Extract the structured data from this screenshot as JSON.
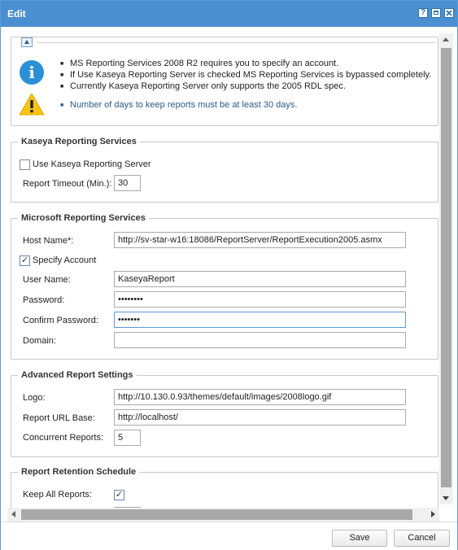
{
  "window": {
    "title": "Edit",
    "controls": {
      "help": "?",
      "restore": "□",
      "close": "✕"
    }
  },
  "info": {
    "messages": [
      "MS Reporting Services 2008 R2 requires you to specify an account.",
      "If Use Kaseya Reporting Server is checked MS Reporting Services is bypassed completely.",
      "Currently Kaseya Reporting Server only supports the 2005 RDL spec."
    ],
    "warning": "Number of days to keep reports must be at least 30 days."
  },
  "kaseya": {
    "legend": "Kaseya Reporting Services",
    "use_server_label": "Use Kaseya Reporting Server",
    "use_server_checked": false,
    "timeout_label": "Report Timeout (Min.):",
    "timeout_value": "30"
  },
  "microsoft": {
    "legend": "Microsoft Reporting Services",
    "host_label": "Host Name*:",
    "host_value": "http://sv-star-w16:18086/ReportServer/ReportExecution2005.asmx",
    "specify_account_label": "Specify Account",
    "specify_account_checked": true,
    "username_label": "User Name:",
    "username_value": "KaseyaReport",
    "password_label": "Password:",
    "password_value": "••••••••",
    "confirm_label": "Confirm Password:",
    "confirm_value": "•••••••",
    "domain_label": "Domain:",
    "domain_value": ""
  },
  "advanced": {
    "legend": "Advanced Report Settings",
    "logo_label": "Logo:",
    "logo_value": "http://10.130.0.93/themes/default/images/2008logo.gif",
    "url_base_label": "Report URL Base:",
    "url_base_value": "http://localhost/",
    "concurrent_label": "Concurrent Reports:",
    "concurrent_value": "5"
  },
  "retention": {
    "legend": "Report Retention Schedule",
    "keep_all_label": "Keep All Reports:",
    "keep_all_checked": true
  },
  "footer": {
    "save_label": "Save",
    "cancel_label": "Cancel"
  },
  "icons": {
    "info": "info-icon",
    "warning": "warning-icon",
    "collapse": "collapse-icon"
  },
  "colors": {
    "titlebar": "#4a8fd0",
    "info_icon": "#2b8fd6",
    "warning_icon": "#f6c416",
    "warning_text": "#2a5a8a"
  }
}
